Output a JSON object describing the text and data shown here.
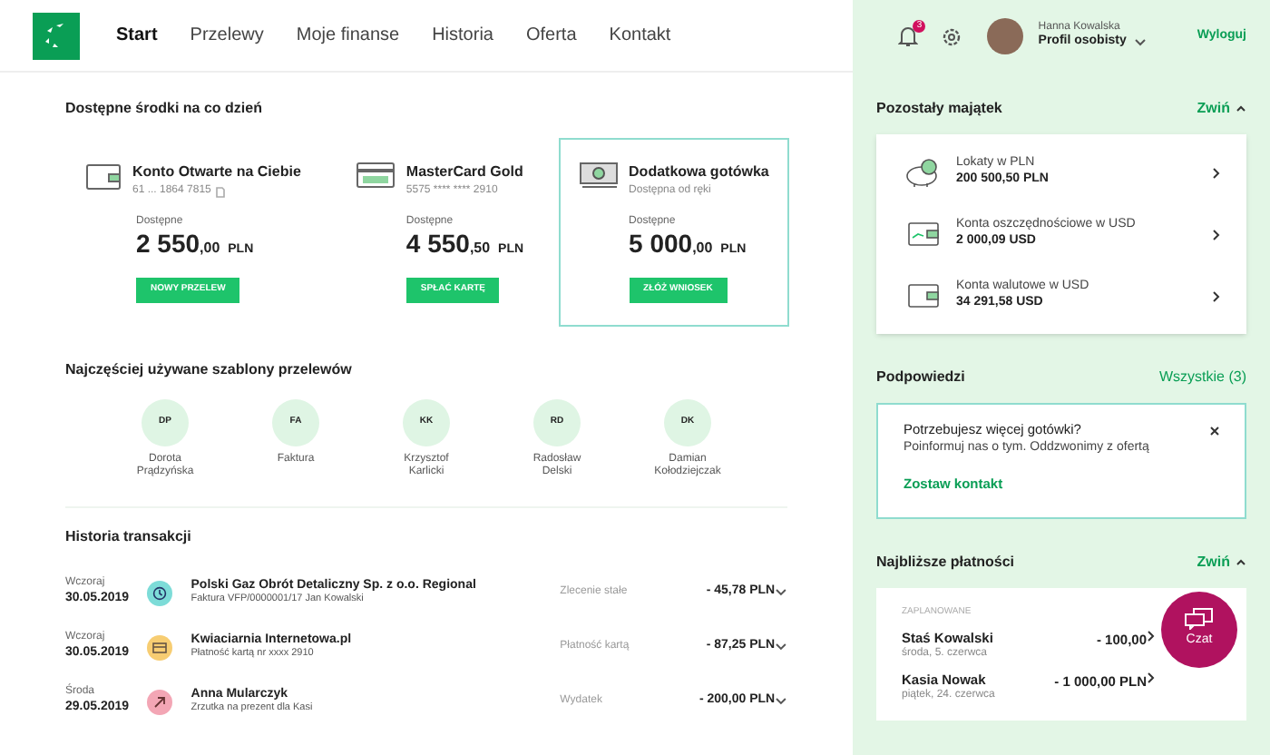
{
  "nav": {
    "tabs": [
      {
        "label": "Start",
        "selected": true
      },
      {
        "label": "Przelewy",
        "selected": false
      },
      {
        "label": "Moje finanse",
        "selected": false
      },
      {
        "label": "Historia",
        "selected": false
      },
      {
        "label": "Oferta",
        "selected": false
      },
      {
        "label": "Kontakt",
        "selected": false
      }
    ]
  },
  "user": {
    "notifications": "3",
    "name": "Hanna Kowalska",
    "profile": "Profil osobisty",
    "logout": "Wyloguj"
  },
  "accounts": {
    "title": "Dostępne środki na co dzień",
    "items": [
      {
        "kind": "wallet",
        "name": "Konto Otwarte na Ciebie",
        "sub": "61 ... 1864 7815",
        "copy": true,
        "label": "Dostępne",
        "amount": "2 550",
        "fraction": ",00",
        "currency": "PLN",
        "button": "NOWY PRZELEW",
        "selected": false
      },
      {
        "kind": "card",
        "name": "MasterCard Gold",
        "sub": "5575 **** **** 2910",
        "copy": false,
        "label": "Dostępne",
        "amount": "4 550",
        "fraction": ",50",
        "currency": "PLN",
        "button": "SPŁAĆ KARTĘ",
        "selected": false
      },
      {
        "kind": "cash",
        "name": "Dodatkowa gotówka",
        "sub": "Dostępna od ręki",
        "copy": false,
        "label": "Dostępne",
        "amount": "5 000",
        "fraction": ",00",
        "currency": "PLN",
        "button": "ZŁÓŻ WNIOSEK",
        "selected": true
      }
    ]
  },
  "templates": {
    "title": "Najczęściej używane szablony przelewów",
    "items": [
      {
        "initials": "DP",
        "name": "Dorota Prądzyńska"
      },
      {
        "initials": "FA",
        "name": "Faktura"
      },
      {
        "initials": "KK",
        "name": "Krzysztof Karlicki"
      },
      {
        "initials": "RD",
        "name": "Radosław Delski"
      },
      {
        "initials": "DK",
        "name": "Damian Kołodziejczak"
      }
    ]
  },
  "history": {
    "title": "Historia transakcji",
    "rows": [
      {
        "day": "Wczoraj",
        "date": "30.05.2019",
        "kind": "clock",
        "title": "Polski Gaz Obrót Detaliczny Sp. z o.o. Regional",
        "detail": "Faktura VFP/0000001/17 Jan Kowalski",
        "type": "Zlecenie stałe",
        "amount": "- 45,78 PLN"
      },
      {
        "day": "Wczoraj",
        "date": "30.05.2019",
        "kind": "card",
        "title": "Kwiaciarnia Internetowa.pl",
        "detail": "Płatność kartą nr xxxx 2910",
        "type": "Płatność kartą",
        "amount": "- 87,25 PLN"
      },
      {
        "day": "Środa",
        "date": "29.05.2019",
        "kind": "arrow",
        "title": "Anna Mularczyk",
        "detail": "Zrzutka na prezent dla Kasi",
        "type": "Wydatek",
        "amount": "- 200,00 PLN"
      }
    ]
  },
  "assets": {
    "title": "Pozostały majątek",
    "toggle": "Zwiń",
    "items": [
      {
        "kind": "piggy",
        "name": "Lokaty w PLN",
        "value": "200 500,50 PLN"
      },
      {
        "kind": "savings",
        "name": "Konta oszczędnościowe w USD",
        "value": "2 000,09 USD"
      },
      {
        "kind": "wallet",
        "name": "Konta walutowe w USD",
        "value": "34 291,58 USD"
      }
    ]
  },
  "hints": {
    "title": "Podpowiedzi",
    "all": "Wszystkie (3)",
    "card": {
      "title": "Potrzebujesz więcej gotówki?",
      "text": "Poinformuj nas o tym. Oddzwonimy z ofertą",
      "link": "Zostaw kontakt"
    }
  },
  "payments": {
    "title": "Najbliższe płatności",
    "toggle": "Zwiń",
    "section": "ZAPLANOWANE",
    "items": [
      {
        "name": "Staś Kowalski",
        "date": "środa, 5. czerwca",
        "amount": "- 100,00"
      },
      {
        "name": "Kasia Nowak",
        "date": "piątek, 24. czerwca",
        "amount": "- 1 000,00 PLN"
      }
    ]
  },
  "chat": {
    "label": "Czat"
  }
}
